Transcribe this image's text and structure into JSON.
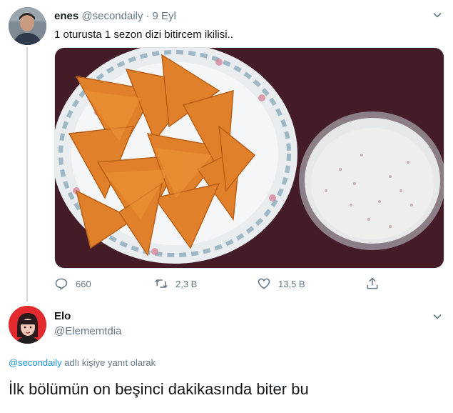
{
  "tweet": {
    "name": "enes",
    "handle": "@secondaily",
    "separator": "·",
    "date": "9 Eyl",
    "text": "1 oturusta 1 sezon dizi bitircem ikilisi..",
    "photo_icon": "chips-and-dip-photo",
    "actions": {
      "reply_count": "660",
      "retweet_count": "2,3 B",
      "like_count": "13,5 B"
    }
  },
  "reply": {
    "name": "Elo",
    "handle": "@Elememtdia",
    "replying_mention": "@secondaily",
    "replying_suffix": "adlı kişiye yanıt olarak",
    "text": "İlk bölümün on beşinci dakikasında biter bu"
  },
  "colors": {
    "text": "#14171a",
    "secondary": "#657786",
    "link": "#1b95e0",
    "divider": "#ccd6dd"
  }
}
